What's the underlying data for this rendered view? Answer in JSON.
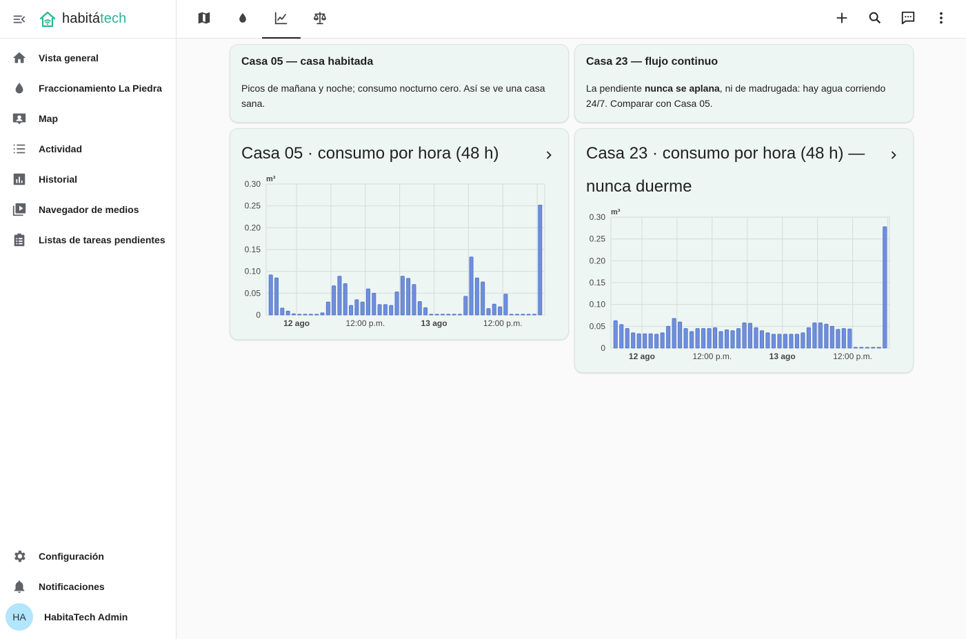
{
  "app": {
    "brand_prefix": "habitá",
    "brand_suffix": "tech",
    "brand_color": "#2bb397"
  },
  "sidebar": {
    "menu_icon": "menu-open-icon",
    "items": [
      {
        "label": "Vista general",
        "icon": "home-icon"
      },
      {
        "label": "Fraccionamiento La Piedra",
        "icon": "water-drop-icon"
      },
      {
        "label": "Map",
        "icon": "account-box-icon"
      },
      {
        "label": "Actividad",
        "icon": "list-icon"
      },
      {
        "label": "Historial",
        "icon": "chart-box-icon"
      },
      {
        "label": "Navegador de medios",
        "icon": "play-box-multiple-icon"
      },
      {
        "label": "Listas de tareas pendientes",
        "icon": "clipboard-list-icon"
      }
    ],
    "bottom": [
      {
        "label": "Configuración",
        "icon": "gear-icon"
      },
      {
        "label": "Notificaciones",
        "icon": "bell-icon"
      }
    ],
    "user": {
      "initials": "HA",
      "name": "HabitaTech Admin"
    }
  },
  "topbar": {
    "tabs": [
      {
        "icon": "map-icon",
        "active": false
      },
      {
        "icon": "water-drop-icon",
        "active": false
      },
      {
        "icon": "line-chart-icon",
        "active": true
      },
      {
        "icon": "scale-balance-icon",
        "active": false
      }
    ],
    "actions": [
      "plus-icon",
      "search-icon",
      "chat-icon",
      "more-vertical-icon"
    ]
  },
  "cards": {
    "casa05_note": {
      "title": "Casa 05 — casa habitada",
      "body": "Picos de mañana y noche; consumo nocturno cero. Así se ve una casa sana."
    },
    "casa23_note": {
      "title": "Casa 23 — flujo continuo",
      "body_pre": "La pendiente ",
      "body_bold": "nunca se aplana",
      "body_post": ", ni de madrugada: hay agua corriendo 24/7. Comparar con Casa 05."
    }
  },
  "chart_data": [
    {
      "type": "bar",
      "title": "Casa 05 · consumo por hora (48 h)",
      "unit": "m³",
      "ylim": [
        0,
        0.3
      ],
      "yticks": [
        "0",
        "0.05",
        "0.10",
        "0.15",
        "0.20",
        "0.25",
        "0.30"
      ],
      "xticks": [
        {
          "label": "12 ago",
          "bold": true,
          "index": 4.5
        },
        {
          "label": "12:00 p.m.",
          "bold": false,
          "index": 16.5
        },
        {
          "label": "13 ago",
          "bold": true,
          "index": 28.5
        },
        {
          "label": "12:00 p.m.",
          "bold": false,
          "index": 40.5
        }
      ],
      "color": "#6f8fdc",
      "values": [
        0.092,
        0.085,
        0.016,
        0.009,
        0.003,
        0.001,
        0.001,
        0.001,
        0.001,
        0.005,
        0.03,
        0.067,
        0.089,
        0.072,
        0.022,
        0.035,
        0.03,
        0.06,
        0.05,
        0.024,
        0.024,
        0.022,
        0.053,
        0.089,
        0.084,
        0.07,
        0.031,
        0.017,
        0.001,
        0.001,
        0.001,
        0.001,
        0.001,
        0.002,
        0.043,
        0.133,
        0.085,
        0.076,
        0.015,
        0.025,
        0.019,
        0.048,
        0.001,
        0.001,
        0.001,
        0.001,
        0.001,
        0.252
      ],
      "grid": true
    },
    {
      "type": "bar",
      "title": "Casa 23 · consumo por hora (48 h) — nunca duerme",
      "unit": "m³",
      "ylim": [
        0,
        0.3
      ],
      "yticks": [
        "0",
        "0.05",
        "0.10",
        "0.15",
        "0.20",
        "0.25",
        "0.30"
      ],
      "xticks": [
        {
          "label": "12 ago",
          "bold": true,
          "index": 4.5
        },
        {
          "label": "12:00 p.m.",
          "bold": false,
          "index": 16.5
        },
        {
          "label": "13 ago",
          "bold": true,
          "index": 28.5
        },
        {
          "label": "12:00 p.m.",
          "bold": false,
          "index": 40.5
        }
      ],
      "color": "#6f8fdc",
      "values": [
        0.063,
        0.054,
        0.045,
        0.035,
        0.033,
        0.033,
        0.033,
        0.032,
        0.035,
        0.05,
        0.068,
        0.06,
        0.045,
        0.038,
        0.045,
        0.045,
        0.045,
        0.047,
        0.038,
        0.042,
        0.04,
        0.045,
        0.058,
        0.057,
        0.047,
        0.04,
        0.035,
        0.032,
        0.032,
        0.032,
        0.032,
        0.032,
        0.035,
        0.047,
        0.058,
        0.058,
        0.055,
        0.05,
        0.043,
        0.045,
        0.044,
        0.001,
        0.001,
        0.001,
        0.001,
        0.001,
        0.278
      ],
      "grid": true
    }
  ]
}
